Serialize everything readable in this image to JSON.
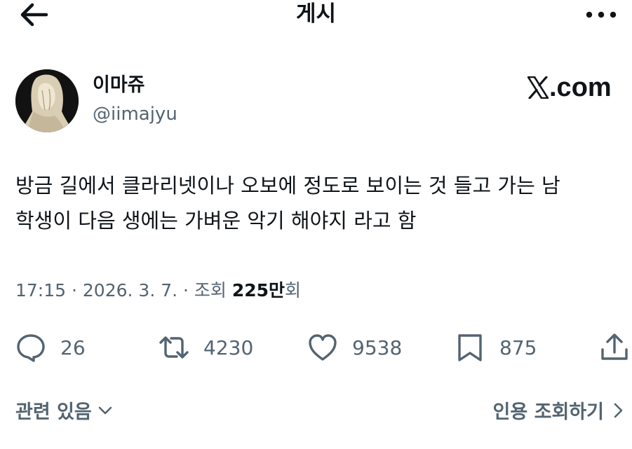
{
  "header": {
    "title": "게시",
    "back_icon": "arrow-left-icon",
    "more_icon": "more-horizontal-icon"
  },
  "author": {
    "display_name": "이마쥬",
    "handle": "@iimajyu",
    "avatar": "veiled-statue-avatar"
  },
  "brand": {
    "logo_text": ".com"
  },
  "tweet": {
    "lines": [
      "방금 길에서 클라리넷이나 오보에 정도로 보이는 것 들고 가는 남",
      "학생이 다음 생에는 가벼운 악기 해야지 라고 함"
    ]
  },
  "meta": {
    "time": "17:15",
    "separator": " · ",
    "date": "2026. 3. 7.",
    "views_label": "조회 ",
    "views_count": "225만",
    "views_unit": "회"
  },
  "actions": {
    "replies": "26",
    "reposts": "4230",
    "likes": "9538",
    "bookmarks": "875"
  },
  "footer": {
    "related_label": "관련 있음",
    "quotes_label": "인용 조회하기"
  },
  "colors": {
    "text": "#0f1419",
    "secondary": "#536471",
    "background": "#ffffff"
  }
}
